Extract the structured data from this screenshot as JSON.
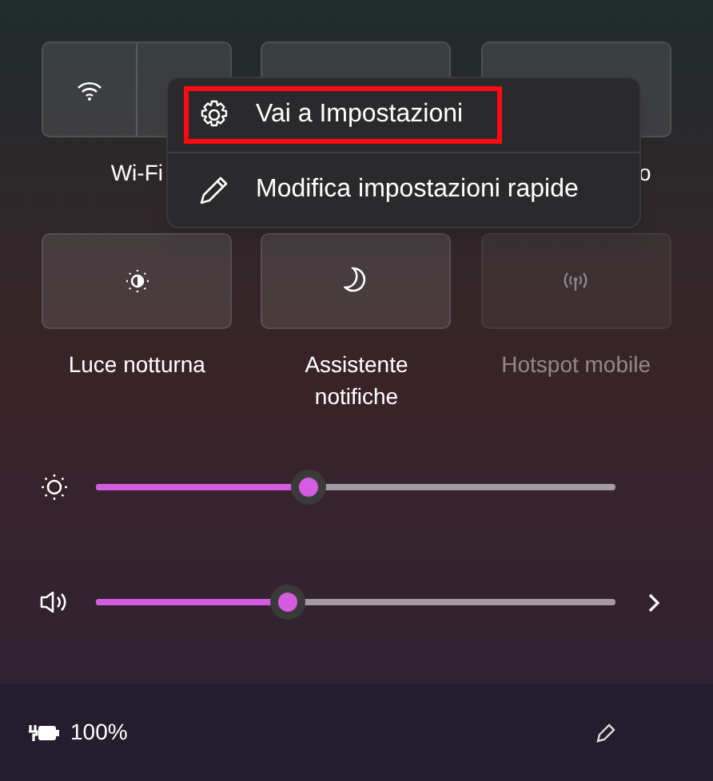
{
  "tiles": [
    {
      "kind": "wifi",
      "label": "Wi-Fi",
      "disabled": false
    },
    {
      "kind": "blank",
      "disabled": false
    },
    {
      "kind": "blank",
      "label": "o",
      "disabled": false
    },
    {
      "kind": "nightlight",
      "label": "Luce notturna",
      "disabled": false
    },
    {
      "kind": "moon",
      "label": "Assistente notifiche",
      "disabled": false
    },
    {
      "kind": "hotspot",
      "label": "Hotspot mobile",
      "disabled": true
    }
  ],
  "sliders": [
    {
      "kind": "brightness",
      "level": 0.41,
      "expandable": false
    },
    {
      "kind": "volume",
      "level": 0.37,
      "expandable": true
    }
  ],
  "battery": {
    "reading": "100%"
  },
  "context_menu": {
    "items": [
      {
        "kind": "settings",
        "label": "Vai a Impostazioni",
        "highlighted": true
      },
      {
        "kind": "edit",
        "label": "Modifica impostazioni rapide",
        "highlighted": false
      }
    ]
  }
}
